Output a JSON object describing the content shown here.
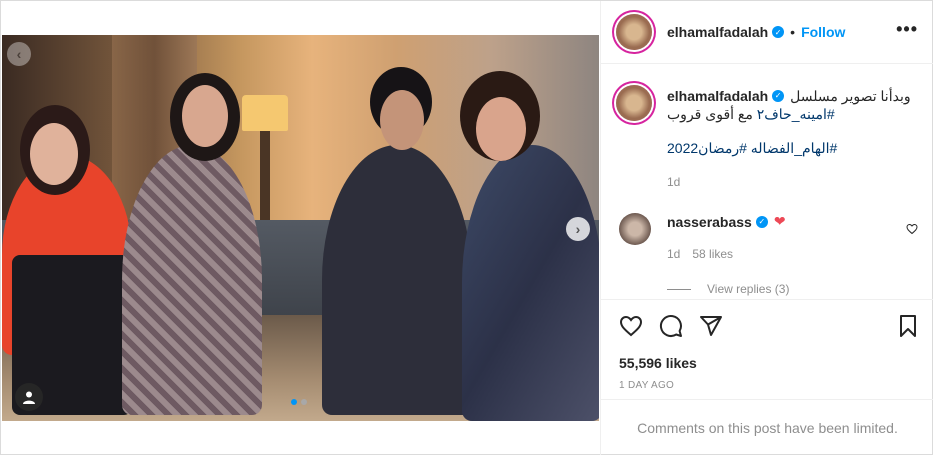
{
  "post": {
    "author": "elhamalfadalah",
    "follow_label": "Follow",
    "separator": "•",
    "more_label": "•••"
  },
  "caption": {
    "username": "elhamalfadalah",
    "text_line1": "وبدأنا تصوير مسلسل",
    "hashtag_line1": "#امينه_حاف٢",
    "text_line2": "مع أقوى قروب",
    "hashtags": "#الهام_الفضاله #رمضان2022",
    "age": "1d"
  },
  "reply": {
    "username": "nasserabass",
    "emoji": "❤",
    "age": "1d",
    "likes": "58 likes",
    "view_replies": "View replies (3)"
  },
  "engagement": {
    "likes": "55,596 likes",
    "date": "1 DAY AGO",
    "comments_limited": "Comments on this post have been limited."
  },
  "carousel": {
    "total": 2,
    "active_index": 0
  },
  "icons": {
    "verified": "verified-badge-icon",
    "heart": "heart-icon",
    "comment": "comment-icon",
    "share": "share-icon",
    "save": "bookmark-icon",
    "tag": "user-tag-icon"
  },
  "colors": {
    "accent": "#0095f6",
    "hashtag": "#00376b",
    "muted": "#8e8e8e"
  }
}
